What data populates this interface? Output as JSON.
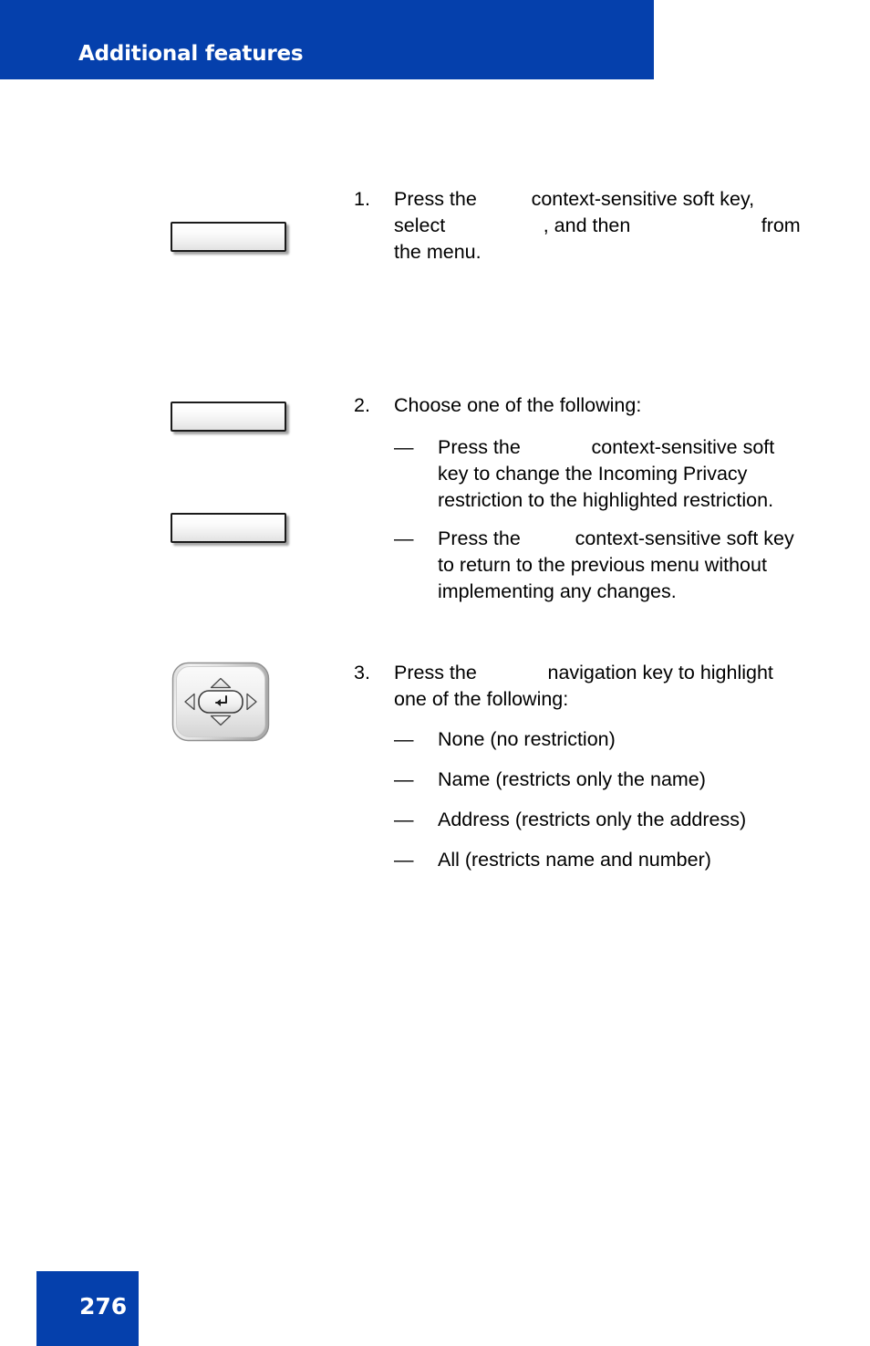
{
  "header": {
    "title": "Additional features",
    "band_color": "#0540ac"
  },
  "footer": {
    "page_number": "276",
    "band_color": "#0540ac"
  },
  "gutter": {
    "softkey_1": {
      "icon": "softkey-button",
      "label": ""
    },
    "softkey_2": {
      "icon": "softkey-button",
      "label": ""
    },
    "softkey_3": {
      "icon": "softkey-button",
      "label": ""
    },
    "navigation_key": {
      "icon": "navigation-cluster-key"
    }
  },
  "steps": [
    {
      "number": "1.",
      "segments": {
        "a": "Press the",
        "blank_1": "          ",
        "b": "context-sensitive soft key, select",
        "blank_2": "                  ",
        "c": ", and then",
        "blank_3": "                        ",
        "d": "from the menu."
      }
    },
    {
      "number": "2.",
      "lead": "Choose one of the following:",
      "dash": "—",
      "items": [
        {
          "a": "Press the",
          "blank": "             ",
          "b": "context-sensitive soft key to change the Incoming Privacy restriction to the highlighted restriction."
        },
        {
          "a": "Press the",
          "blank": "          ",
          "b": "context-sensitive soft key to return to the previous menu without implementing any changes."
        }
      ]
    },
    {
      "number": "3.",
      "lead_a": "Press the",
      "lead_blank": "             ",
      "lead_b": "navigation key to highlight one of the following:",
      "dash": "—",
      "options": [
        "None (no restriction)",
        "Name (restricts only the name)",
        "Address (restricts only the address)",
        "All (restricts name and number)"
      ]
    }
  ]
}
